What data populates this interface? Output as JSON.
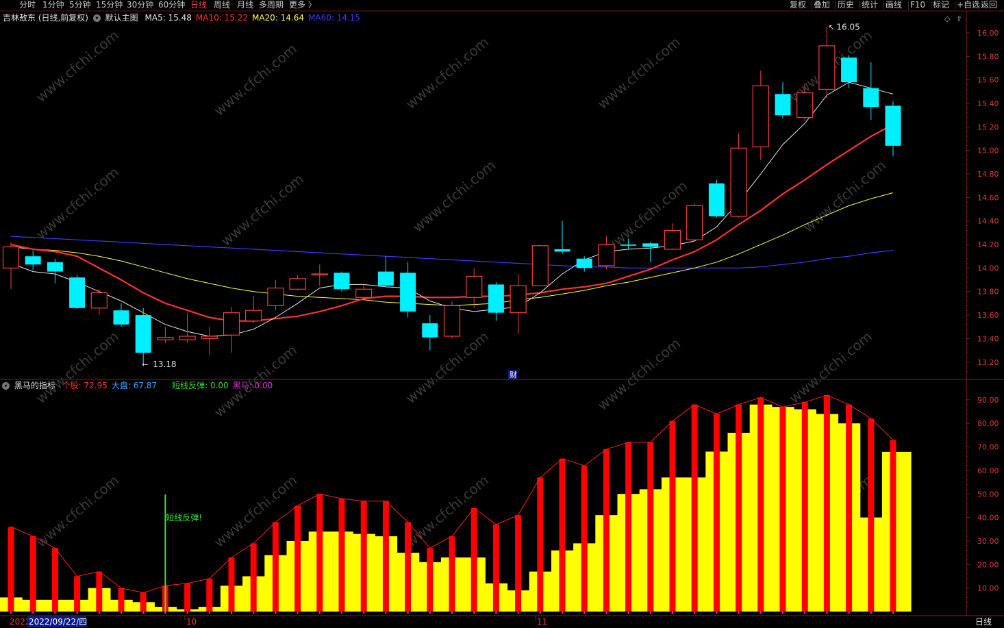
{
  "topbar": {
    "periods": [
      {
        "label": "分时",
        "active": false
      },
      {
        "label": "1分钟",
        "active": false
      },
      {
        "label": "5分钟",
        "active": false
      },
      {
        "label": "15分钟",
        "active": false
      },
      {
        "label": "30分钟",
        "active": false
      },
      {
        "label": "60分钟",
        "active": false
      },
      {
        "label": "日线",
        "active": true
      },
      {
        "label": "周线",
        "active": false
      },
      {
        "label": "月线",
        "active": false
      },
      {
        "label": "多周期",
        "active": false
      },
      {
        "label": "更多 〉",
        "active": false
      }
    ],
    "tools": [
      "复权",
      "叠加",
      "历史",
      "统计",
      "画线",
      "F10",
      "标记",
      "+自选",
      "返回"
    ]
  },
  "main_panel": {
    "stock": "吉林敖东 (日线,前复权)",
    "template": "默认主图",
    "ma": [
      {
        "label": "MA5:",
        "value": "15.48",
        "color": "#e8e8e8"
      },
      {
        "label": "MA10:",
        "value": "15.22",
        "color": "#ff3030"
      },
      {
        "label": "MA20:",
        "value": "14.64",
        "color": "#ffff40"
      },
      {
        "label": "MA60:",
        "value": "14.15",
        "color": "#3a3aff"
      }
    ],
    "high_label": "16.05",
    "low_label": "13.18",
    "fin_marker": "财"
  },
  "indicator_panel": {
    "name": "黑马的指标",
    "values": [
      {
        "label": "个股:",
        "value": "72.95",
        "color": "#ff3030"
      },
      {
        "label": "大盘:",
        "value": "67.87",
        "color": "#3aa0ff"
      },
      {
        "label": "短线反弹:",
        "value": "0.00",
        "color": "#33dd33"
      },
      {
        "label": "黑马:",
        "value": "0.00",
        "color": "#dd33dd"
      }
    ],
    "signal_text": "短线反弹!"
  },
  "bottom": {
    "year": "2022",
    "cursor_date": "2022/09/22/四",
    "months": [
      "10",
      "11"
    ],
    "period": "日线"
  },
  "watermark": "www.cfchi.com",
  "chart_data": [
    {
      "type": "candlestick",
      "y_ticks": [
        "16.00",
        "15.80",
        "15.60",
        "15.40",
        "15.20",
        "15.00",
        "14.80",
        "14.60",
        "14.40",
        "14.20",
        "14.00",
        "13.80",
        "13.60",
        "13.40",
        "13.20"
      ],
      "ylim": [
        13.1,
        16.1
      ],
      "candles": [
        {
          "o": 14.0,
          "c": 14.18,
          "h": 14.22,
          "l": 13.82
        },
        {
          "o": 14.1,
          "c": 14.03,
          "h": 14.15,
          "l": 13.98
        },
        {
          "o": 14.05,
          "c": 13.97,
          "h": 14.08,
          "l": 13.87
        },
        {
          "o": 13.92,
          "c": 13.66,
          "h": 13.94,
          "l": 13.65
        },
        {
          "o": 13.66,
          "c": 13.79,
          "h": 13.82,
          "l": 13.6
        },
        {
          "o": 13.64,
          "c": 13.52,
          "h": 13.7,
          "l": 13.5
        },
        {
          "o": 13.6,
          "c": 13.28,
          "h": 13.66,
          "l": 13.18
        },
        {
          "o": 13.39,
          "c": 13.41,
          "h": 13.5,
          "l": 13.36
        },
        {
          "o": 13.39,
          "c": 13.42,
          "h": 13.62,
          "l": 13.36
        },
        {
          "o": 13.4,
          "c": 13.42,
          "h": 13.5,
          "l": 13.26
        },
        {
          "o": 13.43,
          "c": 13.62,
          "h": 13.67,
          "l": 13.28
        },
        {
          "o": 13.55,
          "c": 13.64,
          "h": 13.76,
          "l": 13.53
        },
        {
          "o": 13.68,
          "c": 13.83,
          "h": 13.9,
          "l": 13.64
        },
        {
          "o": 13.82,
          "c": 13.91,
          "h": 13.94,
          "l": 13.81
        },
        {
          "o": 13.95,
          "c": 13.95,
          "h": 14.03,
          "l": 13.85
        },
        {
          "o": 13.96,
          "c": 13.82,
          "h": 13.97,
          "l": 13.8
        },
        {
          "o": 13.75,
          "c": 13.82,
          "h": 13.86,
          "l": 13.74
        },
        {
          "o": 13.97,
          "c": 13.85,
          "h": 14.1,
          "l": 13.84
        },
        {
          "o": 13.96,
          "c": 13.63,
          "h": 14.05,
          "l": 13.58
        },
        {
          "o": 13.53,
          "c": 13.41,
          "h": 13.6,
          "l": 13.3
        },
        {
          "o": 13.42,
          "c": 13.68,
          "h": 13.72,
          "l": 13.4
        },
        {
          "o": 13.75,
          "c": 13.93,
          "h": 14.0,
          "l": 13.66
        },
        {
          "o": 13.86,
          "c": 13.62,
          "h": 13.88,
          "l": 13.55
        },
        {
          "o": 13.62,
          "c": 13.85,
          "h": 13.95,
          "l": 13.44
        },
        {
          "o": 13.85,
          "c": 14.19,
          "h": 14.2,
          "l": 13.85
        },
        {
          "o": 14.16,
          "c": 14.14,
          "h": 14.4,
          "l": 14.12
        },
        {
          "o": 14.08,
          "c": 14.0,
          "h": 14.1,
          "l": 13.97
        },
        {
          "o": 14.02,
          "c": 14.2,
          "h": 14.27,
          "l": 13.99
        },
        {
          "o": 14.2,
          "c": 14.19,
          "h": 14.25,
          "l": 14.16
        },
        {
          "o": 14.21,
          "c": 14.18,
          "h": 14.22,
          "l": 14.05
        },
        {
          "o": 14.16,
          "c": 14.32,
          "h": 14.38,
          "l": 14.15
        },
        {
          "o": 14.24,
          "c": 14.53,
          "h": 14.55,
          "l": 14.23
        },
        {
          "o": 14.72,
          "c": 14.44,
          "h": 14.75,
          "l": 14.43
        },
        {
          "o": 14.44,
          "c": 15.02,
          "h": 15.15,
          "l": 14.43
        },
        {
          "o": 15.03,
          "c": 15.55,
          "h": 15.68,
          "l": 14.92
        },
        {
          "o": 15.48,
          "c": 15.3,
          "h": 15.58,
          "l": 15.27
        },
        {
          "o": 15.28,
          "c": 15.49,
          "h": 15.57,
          "l": 15.25
        },
        {
          "o": 15.52,
          "c": 15.89,
          "h": 16.05,
          "l": 15.44
        },
        {
          "o": 15.79,
          "c": 15.58,
          "h": 15.81,
          "l": 15.53
        },
        {
          "o": 15.53,
          "c": 15.37,
          "h": 15.75,
          "l": 15.26
        },
        {
          "o": 15.38,
          "c": 15.04,
          "h": 15.42,
          "l": 14.95
        }
      ],
      "ma5": [
        14.04,
        13.97,
        13.95,
        13.88,
        13.8,
        13.72,
        13.62,
        13.52,
        13.46,
        13.42,
        13.43,
        13.48,
        13.58,
        13.7,
        13.83,
        13.86,
        13.86,
        13.84,
        13.83,
        13.72,
        13.66,
        13.63,
        13.65,
        13.67,
        13.79,
        13.95,
        14.07,
        14.14,
        14.16,
        14.17,
        14.19,
        14.23,
        14.35,
        14.56,
        14.8,
        15.05,
        15.23,
        15.47,
        15.58,
        15.53,
        15.48
      ],
      "ma10": [
        14.2,
        14.16,
        14.14,
        14.1,
        14.0,
        13.9,
        13.79,
        13.7,
        13.64,
        13.58,
        13.55,
        13.55,
        13.57,
        13.59,
        13.63,
        13.68,
        13.74,
        13.76,
        13.76,
        13.75,
        13.75,
        13.76,
        13.76,
        13.77,
        13.79,
        13.82,
        13.84,
        13.87,
        13.93,
        13.99,
        14.07,
        14.14,
        14.24,
        14.37,
        14.49,
        14.63,
        14.75,
        14.88,
        15.0,
        15.12,
        15.22
      ],
      "ma20": [
        14.18,
        14.16,
        14.15,
        14.13,
        14.1,
        14.06,
        14.01,
        13.96,
        13.91,
        13.87,
        13.83,
        13.8,
        13.78,
        13.76,
        13.75,
        13.74,
        13.73,
        13.71,
        13.7,
        13.69,
        13.68,
        13.69,
        13.7,
        13.73,
        13.75,
        13.78,
        13.81,
        13.85,
        13.88,
        13.92,
        13.96,
        14.0,
        14.05,
        14.12,
        14.2,
        14.28,
        14.37,
        14.45,
        14.53,
        14.59,
        14.64
      ],
      "ma60": [
        14.27,
        14.26,
        14.25,
        14.24,
        14.23,
        14.22,
        14.21,
        14.2,
        14.19,
        14.18,
        14.17,
        14.16,
        14.15,
        14.14,
        14.13,
        14.12,
        14.11,
        14.1,
        14.09,
        14.08,
        14.07,
        14.06,
        14.05,
        14.04,
        14.03,
        14.02,
        14.01,
        14.01,
        14.0,
        14.0,
        14.0,
        14.0,
        14.0,
        14.0,
        14.01,
        14.03,
        14.05,
        14.08,
        14.1,
        14.13,
        14.15
      ]
    },
    {
      "type": "bar",
      "y_ticks": [
        "90.00",
        "80.00",
        "70.00",
        "60.00",
        "50.00",
        "40.00",
        "30.00",
        "20.00",
        "10.00"
      ],
      "ylim": [
        0,
        95
      ],
      "series": [
        {
          "name": "个股",
          "values": [
            36,
            32,
            27,
            15,
            17,
            10,
            8,
            11,
            12,
            14,
            23,
            29,
            38,
            45,
            50,
            48,
            47,
            47,
            38,
            27,
            32,
            44,
            37,
            41,
            57,
            65,
            62,
            69,
            72,
            72,
            81,
            88,
            84,
            88,
            91,
            87,
            89,
            92,
            88,
            82,
            72.95
          ]
        },
        {
          "name": "大盘",
          "values": [
            6,
            5,
            5,
            5,
            10,
            5,
            4,
            2,
            1,
            2,
            11,
            15,
            24,
            30,
            34,
            34,
            33,
            32,
            25,
            21,
            23,
            23,
            12,
            9,
            17,
            26,
            29,
            41,
            50,
            52,
            57,
            57,
            68,
            76,
            88,
            87,
            86,
            84,
            80,
            40,
            67.87
          ]
        }
      ],
      "signal_index": 7
    }
  ]
}
